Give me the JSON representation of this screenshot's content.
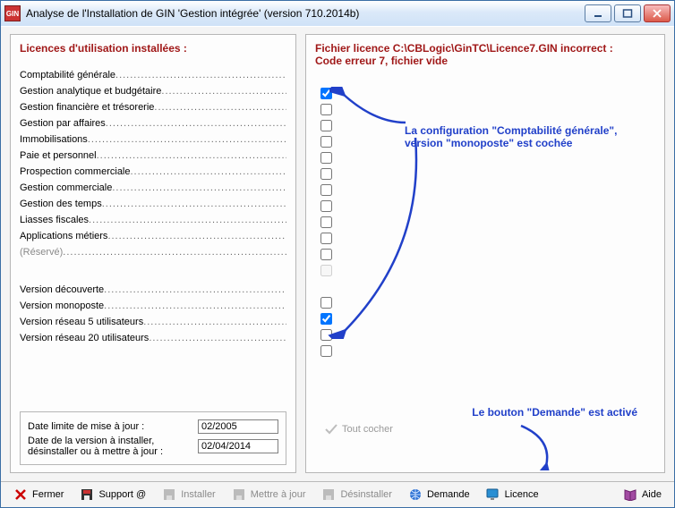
{
  "window": {
    "title": "Analyse de l'Installation de GIN 'Gestion intégrée' (version 710.2014b)",
    "app_icon_text": "GIN"
  },
  "left": {
    "title": "Licences d'utilisation installées :",
    "modules": [
      {
        "label": "Comptabilité générale",
        "checked": true,
        "disabled": false
      },
      {
        "label": "Gestion analytique et budgétaire",
        "checked": false,
        "disabled": false
      },
      {
        "label": "Gestion financière et trésorerie",
        "checked": false,
        "disabled": false
      },
      {
        "label": "Gestion par affaires",
        "checked": false,
        "disabled": false
      },
      {
        "label": "Immobilisations",
        "checked": false,
        "disabled": false
      },
      {
        "label": "Paie et personnel",
        "checked": false,
        "disabled": false
      },
      {
        "label": "Prospection commerciale",
        "checked": false,
        "disabled": false
      },
      {
        "label": "Gestion commerciale",
        "checked": false,
        "disabled": false
      },
      {
        "label": "Gestion des temps",
        "checked": false,
        "disabled": false
      },
      {
        "label": "Liasses fiscales",
        "checked": false,
        "disabled": false
      },
      {
        "label": "Applications métiers",
        "checked": false,
        "disabled": false
      },
      {
        "label": "(Réservé)",
        "checked": false,
        "disabled": true
      }
    ],
    "versions": [
      {
        "label": "Version découverte",
        "checked": false
      },
      {
        "label": "Version monoposte",
        "checked": true
      },
      {
        "label": "Version réseau 5 utilisateurs",
        "checked": false
      },
      {
        "label": "Version réseau 20 utilisateurs",
        "checked": false
      }
    ],
    "dates": {
      "limit_label": "Date limite de mise à jour :",
      "limit_value": "02/2005",
      "install_label": "Date de la version à installer,\ndésinstaller ou à mettre à jour :",
      "install_value": "02/04/2014"
    }
  },
  "right": {
    "err_line1": "Fichier licence C:\\CBLogic\\GinTC\\Licence7.GIN incorrect :",
    "err_line2": "Code erreur 7, fichier vide",
    "annot1": "La configuration \"Comptabilité générale\",\nversion \"monoposte\" est cochée",
    "annot2": "Le bouton \"Demande\" est activé",
    "tout_cocher": "Tout cocher"
  },
  "toolbar": {
    "fermer": "Fermer",
    "support": "Support @",
    "installer": "Installer",
    "maj": "Mettre à jour",
    "desinstaller": "Désinstaller",
    "demande": "Demande",
    "licence": "Licence",
    "aide": "Aide"
  }
}
